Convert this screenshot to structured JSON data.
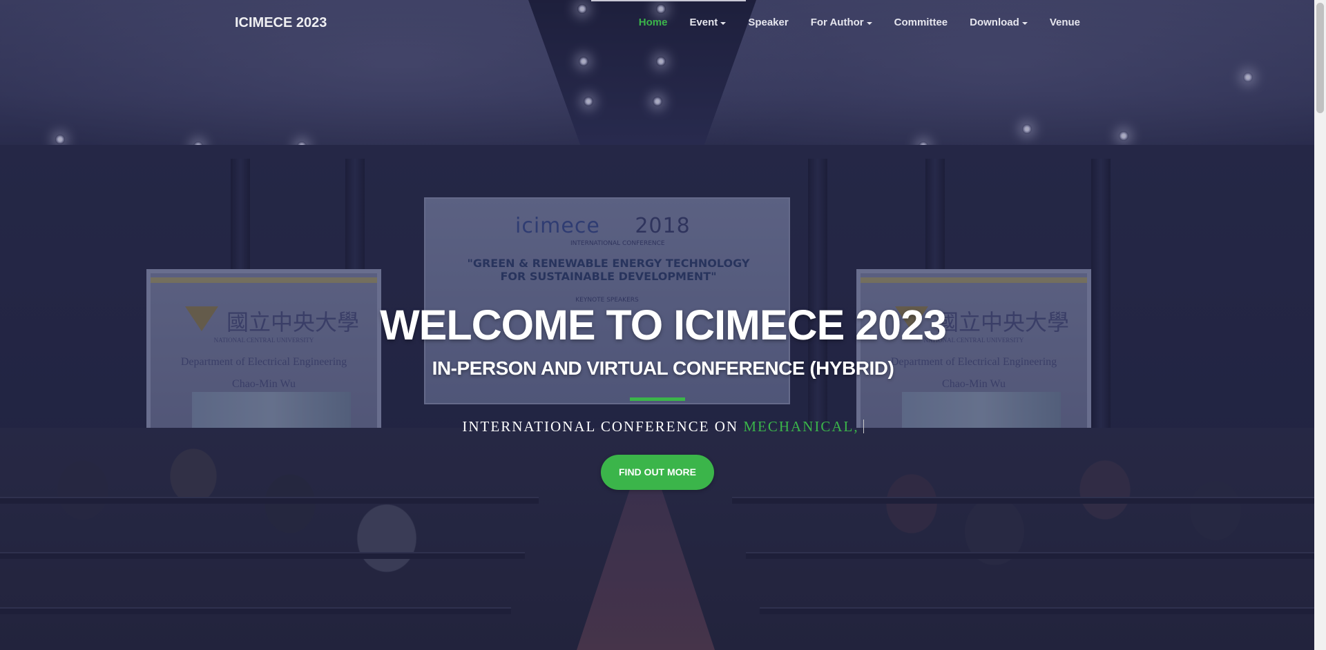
{
  "navbar": {
    "brand": "ICIMECE 2023",
    "items": [
      {
        "label": "Home",
        "active": true,
        "dropdown": false
      },
      {
        "label": "Event",
        "active": false,
        "dropdown": true
      },
      {
        "label": "Speaker",
        "active": false,
        "dropdown": false
      },
      {
        "label": "For Author",
        "active": false,
        "dropdown": true
      },
      {
        "label": "Committee",
        "active": false,
        "dropdown": false
      },
      {
        "label": "Download",
        "active": false,
        "dropdown": true
      },
      {
        "label": "Venue",
        "active": false,
        "dropdown": false
      }
    ]
  },
  "hero": {
    "title": "WELCOME TO ICIMECE 2023",
    "subtitle": "IN-PERSON AND VIRTUAL CONFERENCE (HYBRID)",
    "tagline_prefix": "INTERNATIONAL CONFERENCE ON",
    "tagline_typed": "MECHANICAL,",
    "cta_label": "FIND OUT MORE"
  },
  "background": {
    "banner_logo": "icimece",
    "banner_year": "2018",
    "banner_caption": "INTERNATIONAL CONFERENCE",
    "banner_theme": "\"GREEN & RENEWABLE ENERGY TECHNOLOGY FOR SUSTAINABLE DEVELOPMENT\"",
    "banner_keynote": "KEYNOTE SPEAKERS",
    "screen_university": "國立中央大學",
    "screen_university_en": "NATIONAL CENTRAL UNIVERSITY",
    "screen_department": "Department of Electrical Engineering",
    "screen_name": "Chao-Min Wu"
  },
  "colors": {
    "accent": "#3bb54a",
    "overlay": "#1e2046",
    "text": "#ffffff"
  }
}
